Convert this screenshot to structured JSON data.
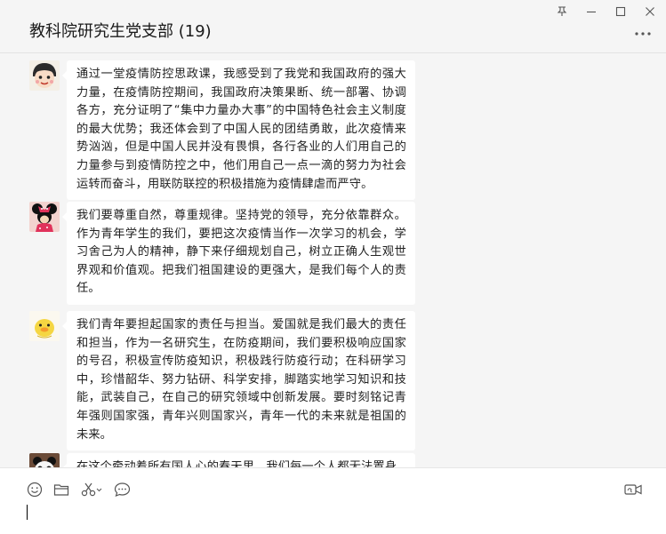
{
  "header": {
    "title": "教科院研究生党支部 (19)"
  },
  "window_controls": {
    "pin_icon": "pin-icon",
    "minimize_icon": "minimize-icon",
    "maximize_icon": "maximize-icon",
    "close_icon": "close-icon"
  },
  "menu": {
    "more_icon": "more-icon"
  },
  "messages": [
    {
      "avatar": "avatar-cartoon-face",
      "text": "通过一堂疫情防控思政课，我感受到了我党和我国政府的强大力量，在疫情防控期间，我国政府决策果断、统一部署、协调各方，充分证明了“集中力量办大事”的中国特色社会主义制度的最大优势；我还体会到了中国人民的团结勇敢，此次疫情来势汹汹，但是中国人民并没有畏惧，各行各业的人们用自己的力量参与到疫情防控之中，他们用自己一点一滴的努力为社会运转而奋斗，用联防联控的积极措施为疫情肆虐而严守。"
    },
    {
      "avatar": "avatar-minnie",
      "text": "我们要尊重自然，尊重规律。坚持党的领导，充分依靠群众。作为青年学生的我们，要把这次疫情当作一次学习的机会，学习舍己为人的精神，静下来仔细规划自己，树立正确人生观世界观和价值观。把我们祖国建设的更强大，是我们每个人的责任。"
    },
    {
      "avatar": "avatar-yellow-duck",
      "text": "我们青年要担起国家的责任与担当。爱国就是我们最大的责任和担当，作为一名研究生，在防疫期间，我们要积极响应国家的号召，积极宣传防疫知识，积极践行防疫行动；在科研学习中，珍惜韶华、努力钻研、科学安排，脚踏实地学习知识和技能，武装自己，在自己的研究领域中创新发展。要时刻铭记青年强则国家强，青年兴则国家兴，青年一代的未来就是祖国的未来。"
    },
    {
      "avatar": "avatar-panda",
      "text": "在这个牵动着所有国人心的春天里，我们每一个人都无法置身"
    }
  ],
  "toolbar": {
    "emoji_icon": "emoji-icon",
    "folder_icon": "folder-icon",
    "screenshot_icon": "scissors-icon",
    "chat_history_icon": "chat-bubble-icon",
    "video_call_icon": "video-call-icon"
  },
  "input": {
    "value": "",
    "placeholder": ""
  }
}
